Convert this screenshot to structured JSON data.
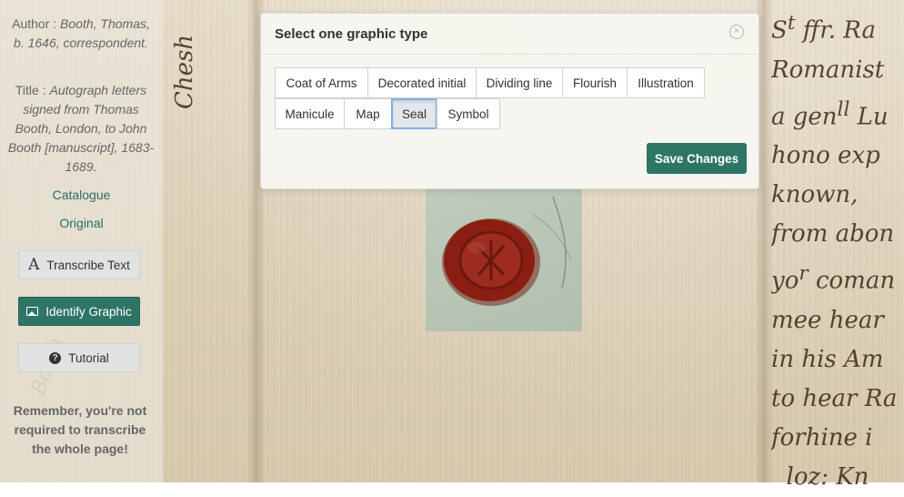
{
  "sidebar": {
    "author_label": "Author : ",
    "author_value": "Booth, Thomas, b. 1646, correspondent.",
    "title_label": "Title : ",
    "title_value": "Autograph letters signed from Thomas Booth, London, to John Booth [manuscript], 1683-1689.",
    "catalogue_link": "Catalogue",
    "original_link": "Original",
    "transcribe_button": "Transcribe Text",
    "identify_button": "Identify Graphic",
    "tutorial_button": "Tutorial",
    "reminder": "Remember, you're not required to transcribe the whole page!"
  },
  "modal": {
    "title": "Select one graphic type",
    "types": [
      "Coat of Arms",
      "Decorated initial",
      "Dividing line",
      "Flourish",
      "Illustration",
      "Manicule",
      "Map",
      "Seal",
      "Symbol"
    ],
    "selected": "Seal",
    "save_button": "Save Changes"
  },
  "colors": {
    "accent": "#2e7566",
    "selected_border": "#7fb0e8",
    "seal_red": "#8b1e12"
  },
  "icons": {
    "transcribe": "letter-a-icon",
    "identify": "image-icon",
    "tutorial": "question-circle-icon",
    "close": "close-circle-icon"
  }
}
